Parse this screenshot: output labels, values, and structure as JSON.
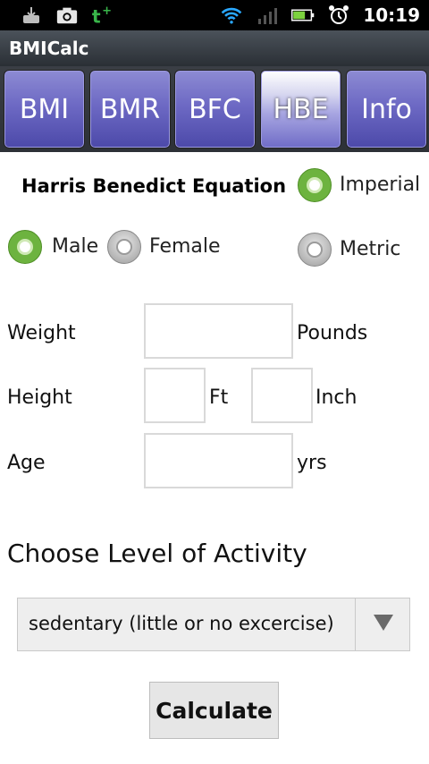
{
  "status_bar": {
    "time": "10:19",
    "icons": [
      "download-icon",
      "camera-icon",
      "t-plus-icon",
      "wifi-icon",
      "signal-icon",
      "battery-icon",
      "alarm-icon"
    ]
  },
  "app": {
    "title": "BMICalc"
  },
  "tabs": [
    {
      "label": "BMI",
      "active": false
    },
    {
      "label": "BMR",
      "active": false
    },
    {
      "label": "BFC",
      "active": false
    },
    {
      "label": "HBE",
      "active": true
    },
    {
      "label": "Info",
      "active": false
    }
  ],
  "form": {
    "heading": "Harris Benedict Equation",
    "units": {
      "imperial_label": "Imperial",
      "metric_label": "Metric",
      "selected": "Imperial"
    },
    "gender": {
      "male_label": "Male",
      "female_label": "Female",
      "selected": "Male"
    },
    "weight": {
      "label": "Weight",
      "value": "",
      "unit": "Pounds"
    },
    "height": {
      "label": "Height",
      "ft_value": "",
      "ft_unit": "Ft",
      "inch_value": "",
      "inch_unit": "Inch"
    },
    "age": {
      "label": "Age",
      "value": "",
      "unit": "yrs"
    }
  },
  "activity": {
    "title": "Choose Level of Activity",
    "selected": "sedentary (little or no excercise)"
  },
  "buttons": {
    "calculate": "Calculate"
  },
  "colors": {
    "radio_checked": "#6db33f",
    "tab_base": "#6d69c4"
  }
}
